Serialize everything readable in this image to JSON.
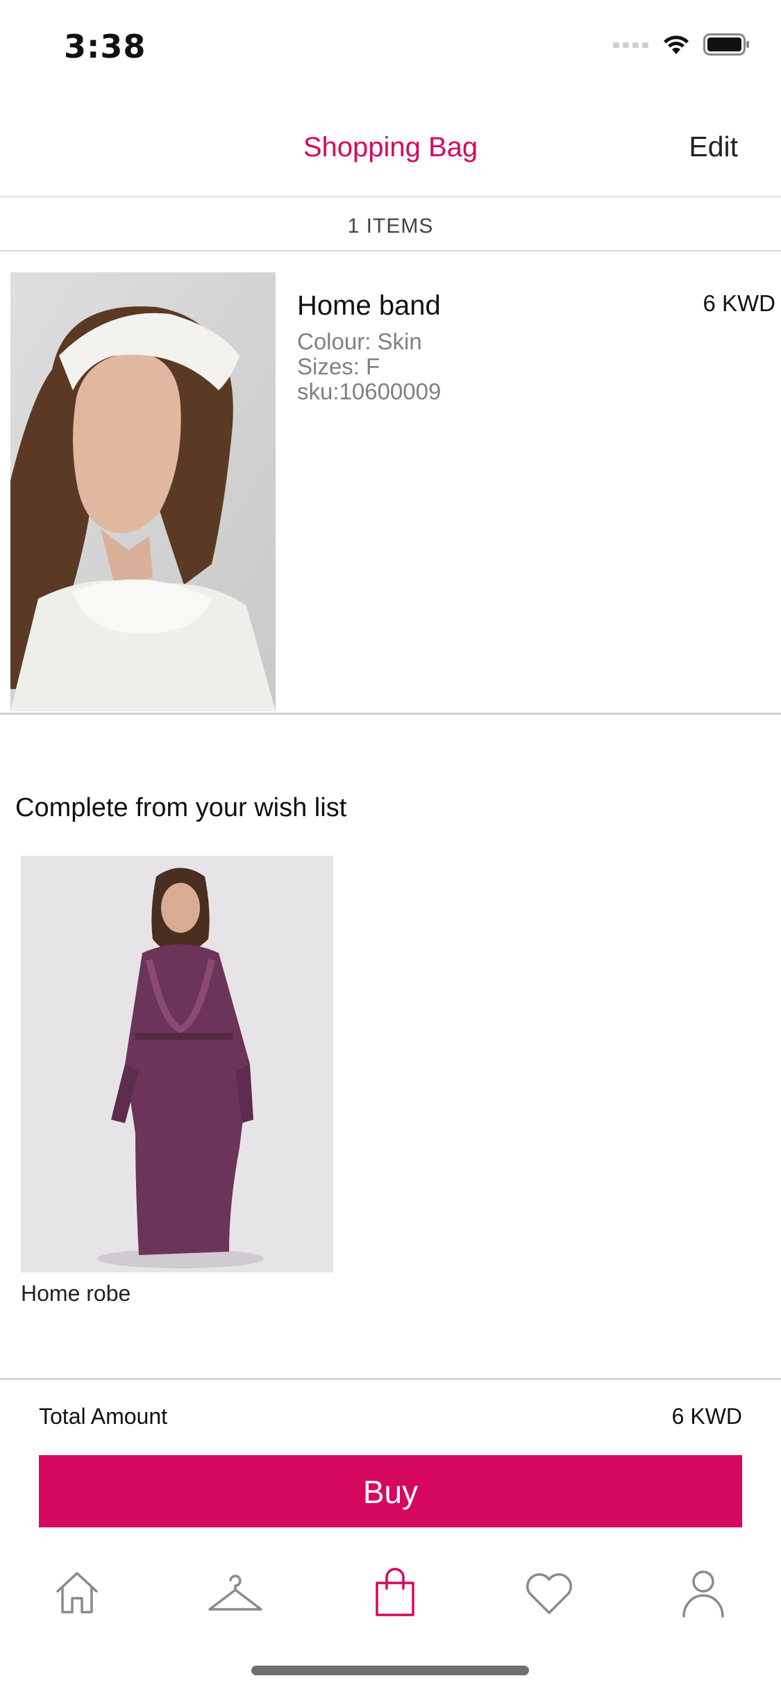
{
  "status_bar": {
    "time": "3:38"
  },
  "nav": {
    "title": "Shopping Bag",
    "edit_label": "Edit"
  },
  "bag": {
    "items_count_label": "1 ITEMS"
  },
  "cart_items": [
    {
      "name": "Home band",
      "price": "6 KWD",
      "colour": "Colour: Skin",
      "size": "Sizes: F",
      "sku": "sku:10600009"
    }
  ],
  "wishlist": {
    "title": "Complete from your wish list",
    "items": [
      {
        "name": "Home robe"
      }
    ]
  },
  "summary": {
    "total_label": "Total Amount",
    "total_value": "6 KWD",
    "buy_label": "Buy"
  },
  "tab_bar": {
    "active_color": "#d6075f",
    "inactive_color": "#8a8a8a",
    "tabs": [
      {
        "icon": "home-icon",
        "active": false
      },
      {
        "icon": "hanger-icon",
        "active": false
      },
      {
        "icon": "shopping-bag-icon",
        "active": true
      },
      {
        "icon": "heart-icon",
        "active": false
      },
      {
        "icon": "profile-icon",
        "active": false
      }
    ]
  },
  "colors": {
    "accent": "#d6075f"
  }
}
